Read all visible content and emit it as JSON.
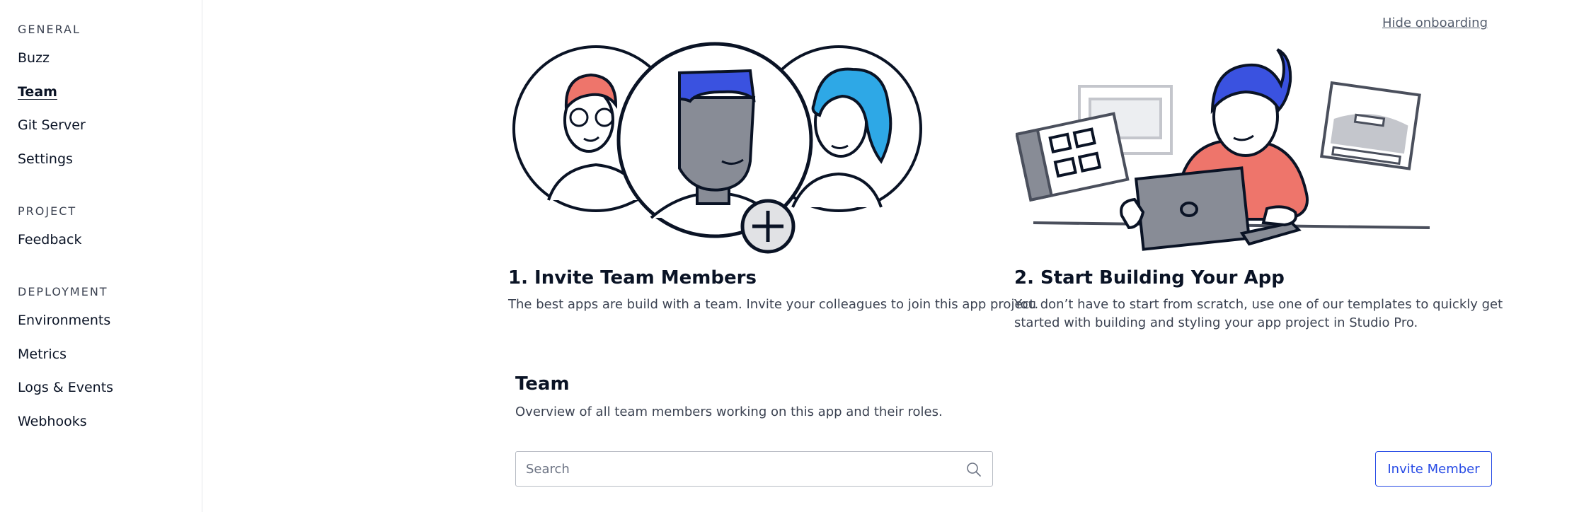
{
  "sidebar": {
    "sections": [
      {
        "title": "GENERAL",
        "items": [
          "Buzz",
          "Team",
          "Git Server",
          "Settings"
        ]
      },
      {
        "title": "PROJECT",
        "items": [
          "Feedback"
        ]
      },
      {
        "title": "DEPLOYMENT",
        "items": [
          "Environments",
          "Metrics",
          "Logs & Events",
          "Webhooks"
        ]
      }
    ],
    "active_item": "Team"
  },
  "header": {
    "hide_onboarding": "Hide onboarding"
  },
  "onboarding": {
    "step1": {
      "title": "1. Invite Team Members",
      "description": "The best apps are build with a team. Invite your colleagues to join this app project."
    },
    "step2": {
      "title": "2. Start Building Your App",
      "description_line1": "You don’t have to start from scratch, use one of our templates to quickly get",
      "description_line2": "started with building and styling your app project in Studio Pro."
    }
  },
  "team": {
    "title": "Team",
    "description": "Overview of all team members working on this app and their roles.",
    "search_placeholder": "Search",
    "invite_label": "Invite Member"
  },
  "colors": {
    "accent": "#264ae5",
    "illustration_blue": "#3a52e0",
    "illustration_red": "#ee756b",
    "illustration_cyan": "#2ea8e6"
  }
}
